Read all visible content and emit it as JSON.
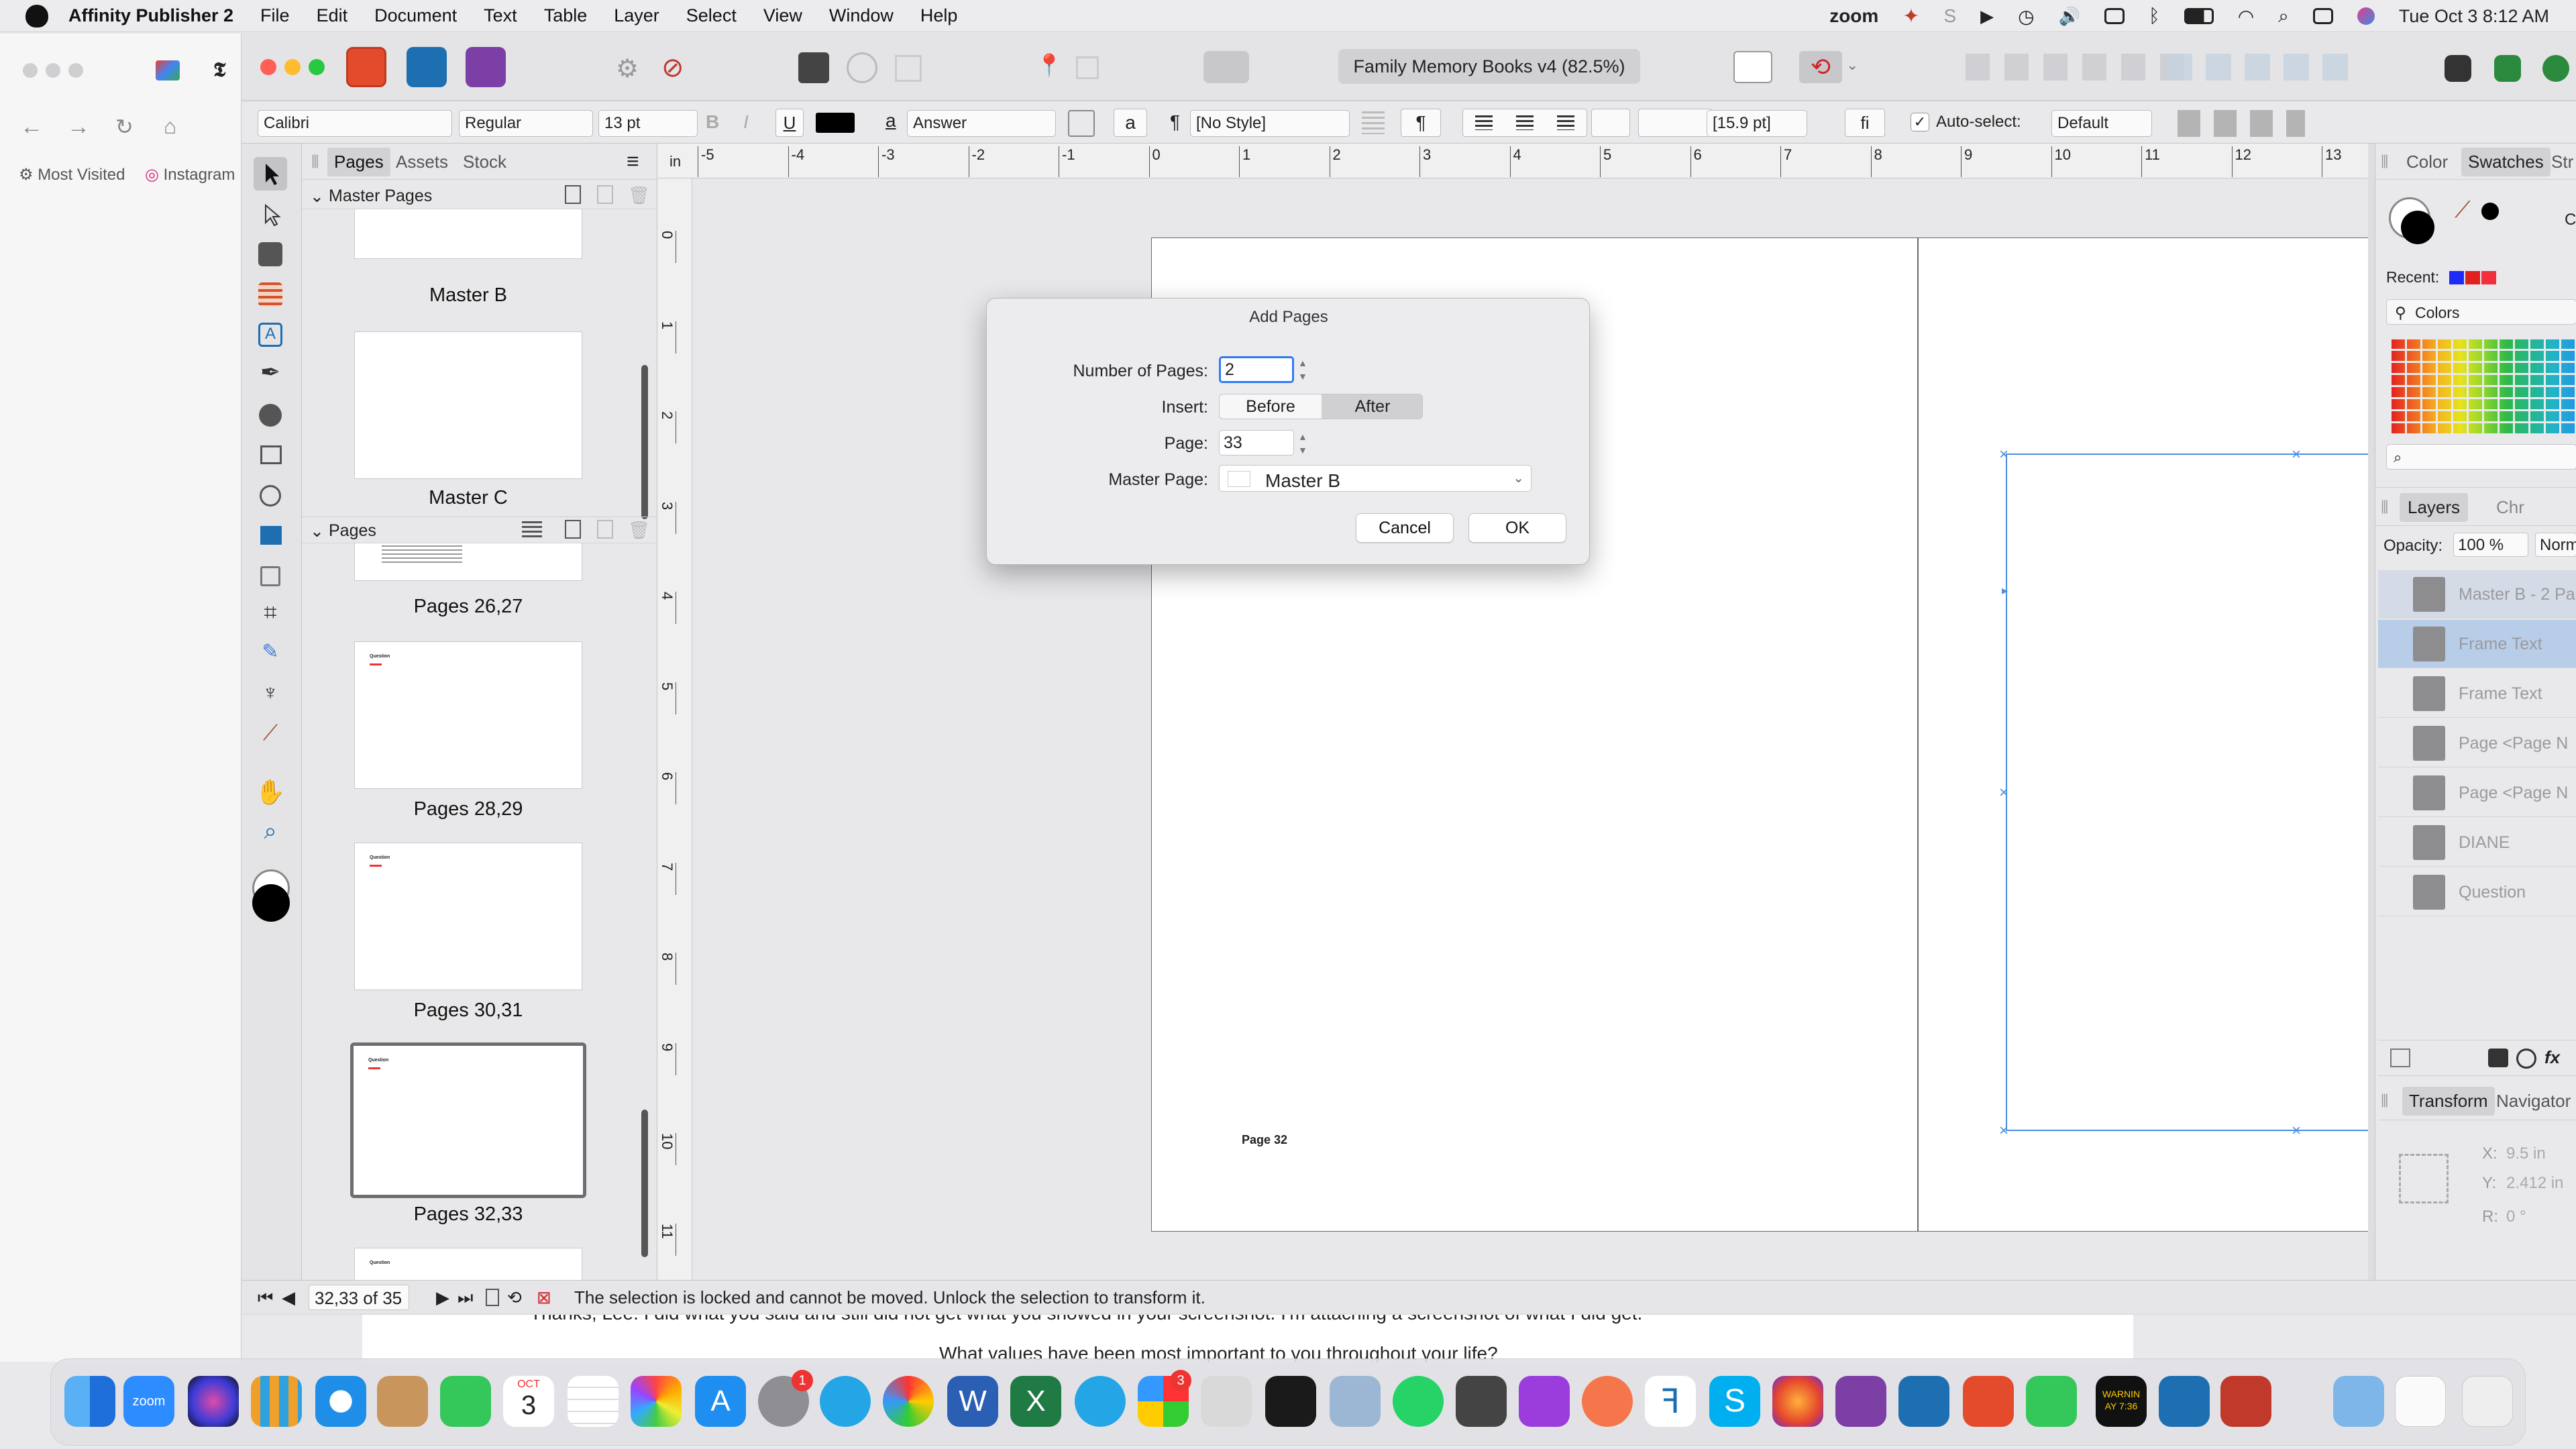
{
  "menubar": {
    "app_name": "Affinity Publisher 2",
    "items": [
      "File",
      "Edit",
      "Document",
      "Text",
      "Table",
      "Layer",
      "Select",
      "View",
      "Window",
      "Help"
    ],
    "zoom_label": "zoom",
    "datetime": "Tue Oct 3  8:12 AM"
  },
  "browser": {
    "bookmark_1": "Most Visited",
    "bookmark_2": "Instagram"
  },
  "window": {
    "doc_title": "Family Memory Books v4 (82.5%)"
  },
  "context_toolbar": {
    "font": "Calibri",
    "style": "Regular",
    "size": "13 pt",
    "bold": "B",
    "italic": "I",
    "underline": "U",
    "char_style": "Answer",
    "para_style": "[No Style]",
    "pilcrow": "¶",
    "leading": "[15.9 pt]",
    "ligature": "fi",
    "autoselect_label": "Auto-select:",
    "autoselect_value": "Default",
    "char_a": "a"
  },
  "pages_panel": {
    "tabs": [
      "Pages",
      "Assets",
      "Stock"
    ],
    "master_section": "Master Pages",
    "pages_section": "Pages",
    "masters": [
      "Master B",
      "Master C"
    ],
    "spreads": [
      "Pages 26,27",
      "Pages 28,29",
      "Pages 30,31",
      "Pages 32,33"
    ],
    "thumb_text": "Question"
  },
  "ruler": {
    "h_unit": "in",
    "h_ticks": [
      "-5",
      "-4",
      "-3",
      "-2",
      "-1",
      "0",
      "1",
      "2",
      "3",
      "4",
      "5",
      "6",
      "7",
      "8",
      "9",
      "10",
      "11",
      "12",
      "13"
    ],
    "v_ticks": [
      "0",
      "1",
      "2",
      "3",
      "4",
      "5",
      "6",
      "7",
      "8",
      "9",
      "10",
      "11"
    ]
  },
  "canvas": {
    "page_label": "Page 32"
  },
  "dialog": {
    "title": "Add Pages",
    "num_pages_label": "Number of Pages:",
    "num_pages_value": "2",
    "insert_label": "Insert:",
    "before": "Before",
    "after": "After",
    "page_label": "Page:",
    "page_value": "33",
    "master_label": "Master Page:",
    "master_value": "Master B",
    "cancel": "Cancel",
    "ok": "OK",
    "selected_insert": "After"
  },
  "right_panel": {
    "top_tabs": [
      "Color",
      "Swatches",
      "Str"
    ],
    "recent_label": "Recent:",
    "palette_name": "Colors",
    "layer_tabs": [
      "Layers",
      "Chr"
    ],
    "opacity_label": "Opacity:",
    "opacity_value": "100 %",
    "blend_value": "Norm",
    "layers": [
      "Master B - 2 Pa",
      "Frame Text",
      "Frame Text",
      "Page <Page N",
      "Page <Page N",
      "DIANE",
      "Question"
    ],
    "bottom_tabs": [
      "Transform",
      "Navigator"
    ],
    "x_label": "X:",
    "x_value": "9.5 in",
    "y_label": "Y:",
    "y_value": "2.412 in",
    "r_label": "R:",
    "r_value": "0 °",
    "c_label": "C"
  },
  "status_bar": {
    "page_indicator": "32,33 of 35",
    "message": "The selection is locked and cannot be moved. Unlock the selection to transform it."
  },
  "background_text": {
    "email_line": "Thanks, Lee. I did what you said and still did not get what you showed in your screenshot. I'm attaching a screenshot of what I did get.",
    "email_line2": "What values have been most important to you throughout your life?"
  },
  "dock": {
    "calendar_month": "OCT",
    "calendar_day": "3",
    "badge_settings": "1",
    "badge_photos": "3",
    "warning_text": "WARNIN\nAY 7:36",
    "zoom_text": "zoom"
  },
  "colors": {
    "accent": "#2f7bf6",
    "selection_blue": "#4a8fe0",
    "dialog_bg": "#ececee"
  }
}
